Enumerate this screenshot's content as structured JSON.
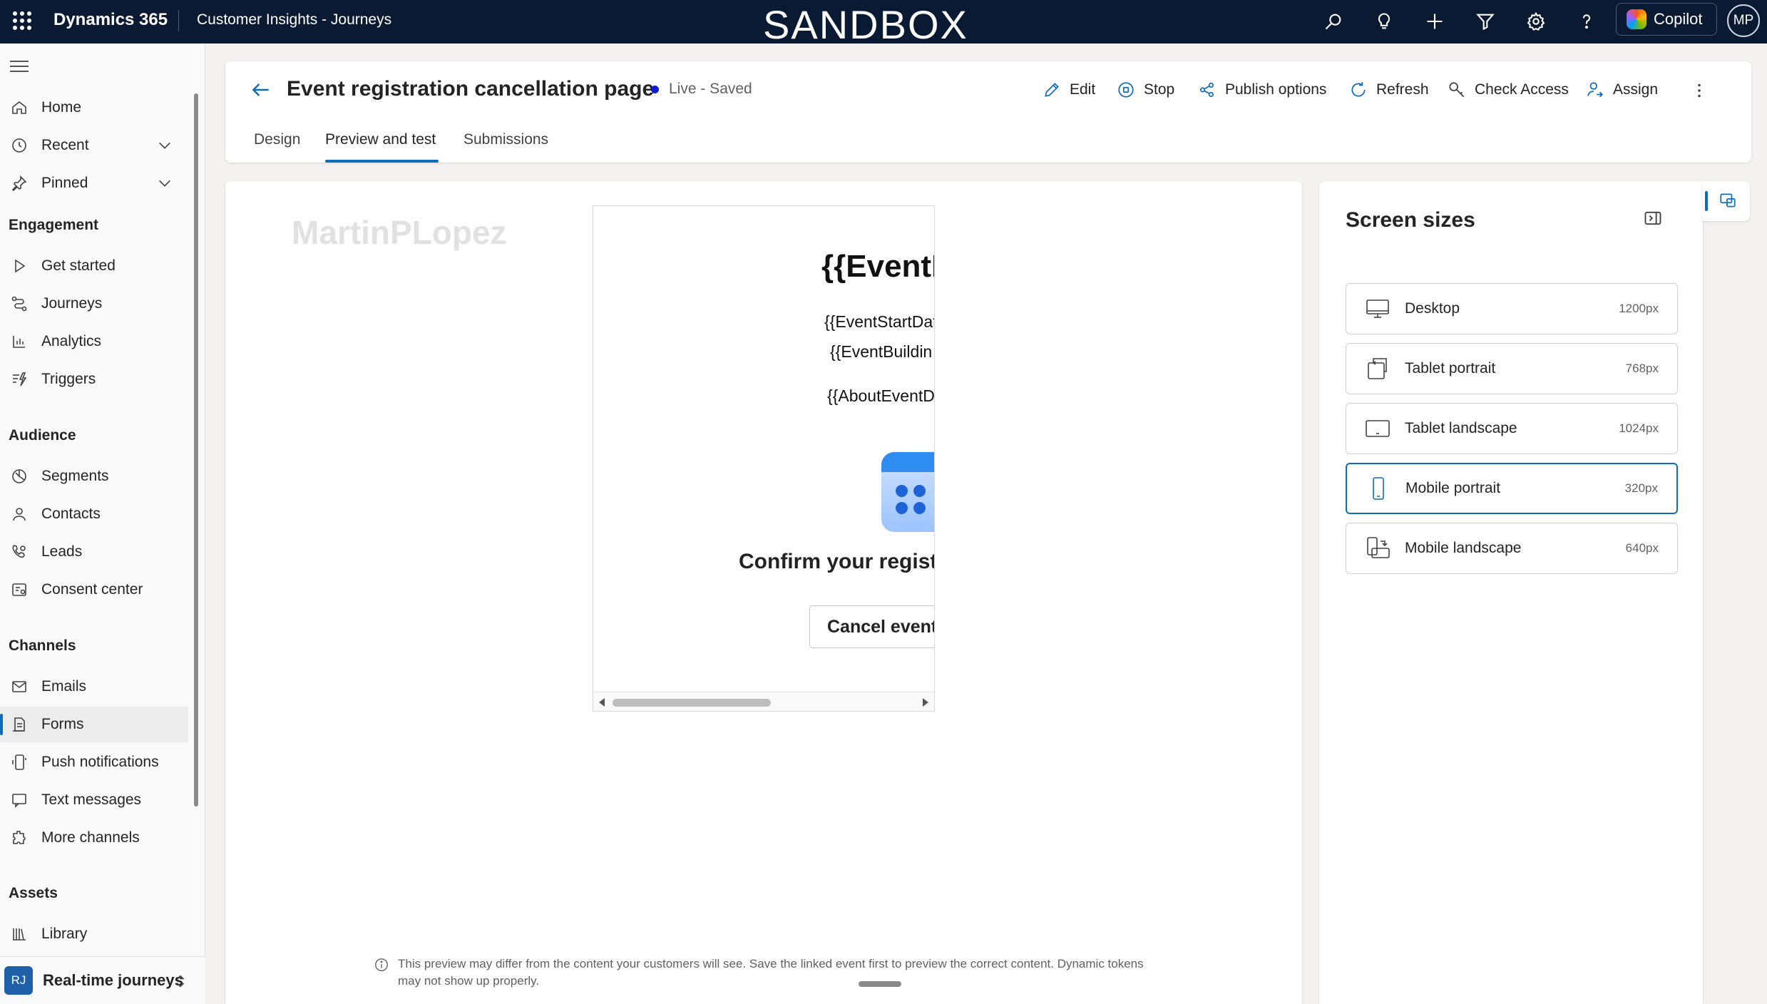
{
  "topbar": {
    "brand": "Dynamics 365",
    "app_name": "Customer Insights - Journeys",
    "environment": "SANDBOX",
    "copilot_label": "Copilot",
    "user_initials": "MP",
    "icons": [
      "search-icon",
      "lightbulb-icon",
      "plus-icon",
      "filter-icon",
      "gear-icon",
      "help-icon"
    ]
  },
  "sidebar": {
    "items_top": [
      {
        "label": "Home",
        "icon": "home-icon"
      },
      {
        "label": "Recent",
        "icon": "clock-icon"
      },
      {
        "label": "Pinned",
        "icon": "pin-icon"
      }
    ],
    "groups": [
      {
        "heading": "Engagement",
        "items": [
          {
            "label": "Get started",
            "icon": "play-icon"
          },
          {
            "label": "Journeys",
            "icon": "journey-icon"
          },
          {
            "label": "Analytics",
            "icon": "chart-icon"
          },
          {
            "label": "Triggers",
            "icon": "trigger-icon"
          }
        ]
      },
      {
        "heading": "Audience",
        "items": [
          {
            "label": "Segments",
            "icon": "segments-icon"
          },
          {
            "label": "Contacts",
            "icon": "person-icon"
          },
          {
            "label": "Leads",
            "icon": "phone-person-icon"
          },
          {
            "label": "Consent center",
            "icon": "consent-icon"
          }
        ]
      },
      {
        "heading": "Channels",
        "items": [
          {
            "label": "Emails",
            "icon": "mail-icon"
          },
          {
            "label": "Forms",
            "icon": "form-icon"
          },
          {
            "label": "Push notifications",
            "icon": "push-icon"
          },
          {
            "label": "Text messages",
            "icon": "message-icon"
          },
          {
            "label": "More channels",
            "icon": "puzzle-icon"
          }
        ]
      },
      {
        "heading": "Assets",
        "items": [
          {
            "label": "Library",
            "icon": "library-icon"
          }
        ]
      }
    ],
    "active_item": "Forms",
    "area": {
      "initials": "RJ",
      "label": "Real-time journeys"
    }
  },
  "header": {
    "title": "Event registration cancellation page",
    "status": "Live - Saved",
    "status_color": "#0f1bd6",
    "commands": [
      {
        "label": "Edit",
        "icon": "pencil-icon"
      },
      {
        "label": "Stop",
        "icon": "stop-icon"
      },
      {
        "label": "Publish options",
        "icon": "share-icon"
      },
      {
        "label": "Refresh",
        "icon": "refresh-icon"
      },
      {
        "label": "Check Access",
        "icon": "key-icon"
      },
      {
        "label": "Assign",
        "icon": "assign-icon"
      }
    ],
    "tabs": [
      {
        "label": "Design"
      },
      {
        "label": "Preview and test"
      },
      {
        "label": "Submissions"
      }
    ],
    "active_tab": "Preview and test"
  },
  "preview": {
    "watermark": "MartinPLopez",
    "frame": {
      "title": "{{EventN",
      "line1": "{{EventStartDat",
      "line2": "{{EventBuildin",
      "line3": "{{AboutEventD",
      "confirm": "Confirm your registr",
      "button": "Cancel event r"
    },
    "note": "This preview may differ from the content your customers will see. Save the linked event first to preview the correct content. Dynamic tokens may not show up properly."
  },
  "screen_sizes": {
    "title": "Screen sizes",
    "options": [
      {
        "label": "Desktop",
        "size": "1200px",
        "icon": "desktop-icon"
      },
      {
        "label": "Tablet portrait",
        "size": "768px",
        "icon": "tablet-portrait-icon"
      },
      {
        "label": "Tablet landscape",
        "size": "1024px",
        "icon": "tablet-landscape-icon"
      },
      {
        "label": "Mobile portrait",
        "size": "320px",
        "icon": "mobile-portrait-icon"
      },
      {
        "label": "Mobile landscape",
        "size": "640px",
        "icon": "mobile-landscape-icon"
      }
    ],
    "selected": "Mobile portrait"
  },
  "colors": {
    "accent": "#0f6cbd",
    "topbar": "#0b1a33"
  }
}
